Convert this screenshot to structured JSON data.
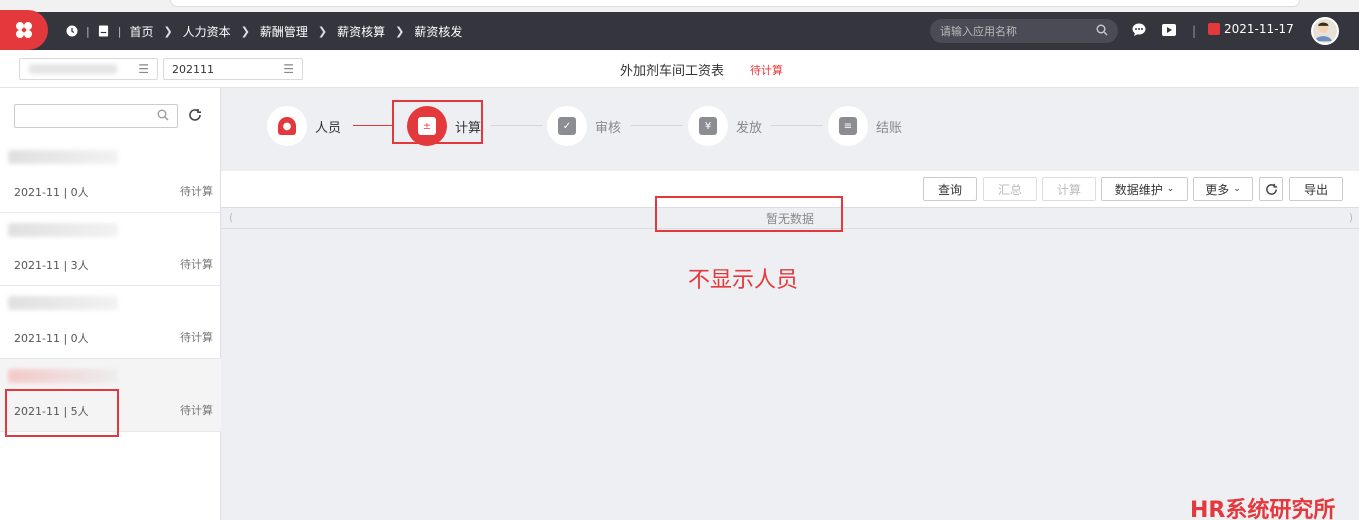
{
  "header": {
    "breadcrumb": [
      "首页",
      "人力资本",
      "薪酬管理",
      "薪资核算",
      "薪资核发"
    ],
    "search_placeholder": "请输入应用名称",
    "date": "2021-11-17"
  },
  "subheader": {
    "period_value": "202111",
    "doc_title": "外加剂车间工资表",
    "doc_status": "待计算"
  },
  "left_panel": {
    "items": [
      {
        "meta": "2021-11 | 0人",
        "status": "待计算"
      },
      {
        "meta": "2021-11 | 3人",
        "status": "待计算"
      },
      {
        "meta": "2021-11 | 0人",
        "status": "待计算"
      },
      {
        "meta": "2021-11 | 5人",
        "status": "待计算"
      }
    ]
  },
  "steps": [
    {
      "label": "人员",
      "state": "done"
    },
    {
      "label": "计算",
      "state": "active"
    },
    {
      "label": "审核",
      "state": "pending"
    },
    {
      "label": "发放",
      "state": "pending"
    },
    {
      "label": "结账",
      "state": "pending"
    }
  ],
  "toolbar": {
    "query": "查询",
    "summary": "汇总",
    "calculate": "计算",
    "data_maintain": "数据维护",
    "more": "更多",
    "export": "导出"
  },
  "grid": {
    "empty_text": "暂无数据"
  },
  "annotation": {
    "text": "不显示人员"
  },
  "watermark": {
    "text": "HR系统研究所"
  },
  "colors": {
    "accent": "#e4393c",
    "header_bg": "#34353d",
    "main_bg": "#eeeff2"
  }
}
